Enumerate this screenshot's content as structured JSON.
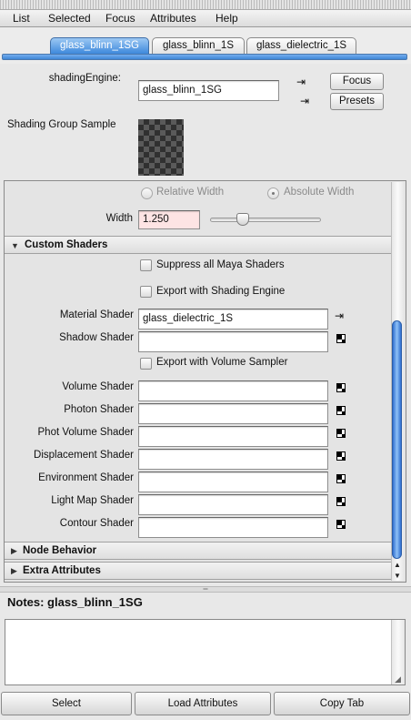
{
  "menu": [
    "List",
    "Selected",
    "Focus",
    "Attributes",
    "Help"
  ],
  "tabs": [
    "glass_blinn_1SG",
    "glass_blinn_1S",
    "glass_dielectric_1S"
  ],
  "active_tab": "glass_blinn_1SG",
  "header": {
    "shading_engine_label": "shadingEngine:",
    "shading_engine_value": "glass_blinn_1SG",
    "focus_button": "Focus",
    "presets_button": "Presets",
    "sample_label": "Shading Group Sample"
  },
  "width_section": {
    "relative_width": "Relative Width",
    "absolute_width": "Absolute Width",
    "width_label": "Width",
    "width_value": "1.250",
    "width_slider_fraction": 0.27
  },
  "custom_shaders": {
    "title": "Custom Shaders",
    "suppress_all": "Suppress all Maya Shaders",
    "export_with_engine": "Export with Shading Engine",
    "material_shader_label": "Material Shader",
    "material_shader_value": "glass_dielectric_1S",
    "shadow_shader_label": "Shadow Shader",
    "shadow_shader_value": "",
    "export_with_volume": "Export with Volume Sampler",
    "volume_shader_label": "Volume Shader",
    "photon_shader_label": "Photon Shader",
    "phot_volume_shader_label": "Phot Volume Shader",
    "displacement_shader_label": "Displacement Shader",
    "environment_shader_label": "Environment Shader",
    "light_map_shader_label": "Light Map Shader",
    "contour_shader_label": "Contour Shader"
  },
  "sections": {
    "node_behavior": "Node Behavior",
    "extra_attributes": "Extra Attributes"
  },
  "notes": {
    "title": "Notes: glass_blinn_1SG",
    "content": ""
  },
  "bottom_buttons": {
    "select": "Select",
    "load_attributes": "Load Attributes",
    "copy_tab": "Copy Tab"
  },
  "colors": {
    "accent": "#3d88dc",
    "width_field_bg": "#fde4e4"
  }
}
